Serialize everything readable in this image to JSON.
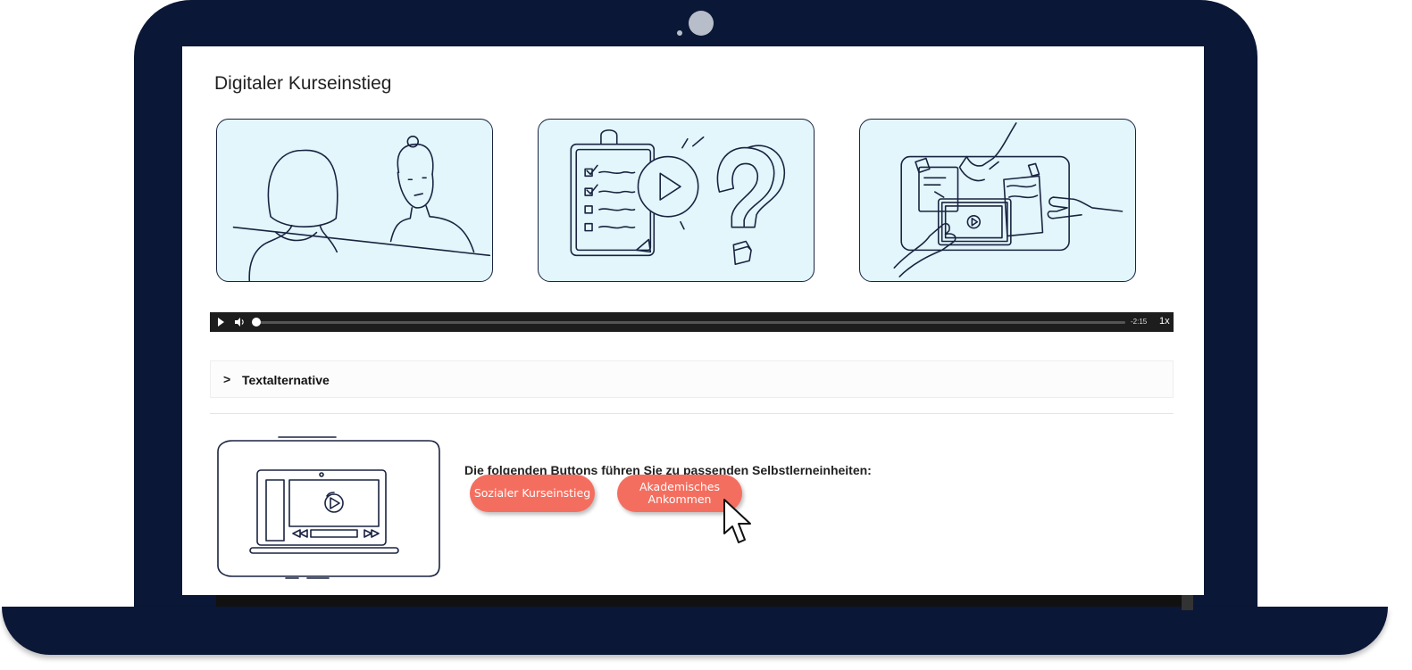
{
  "page": {
    "title": "Digitaler Kurseinstieg"
  },
  "player": {
    "time_remaining": "-2:15",
    "speed": "1x",
    "progress": 0.0
  },
  "accordion": {
    "label": "Textalternative",
    "chevron": ">"
  },
  "selection": {
    "prompt": "Die folgenden Buttons führen Sie zu passenden Selbstlerneinheiten:",
    "buttons": [
      {
        "label": "Sozialer Kurseinstieg"
      },
      {
        "label_line1": "Akademisches",
        "label_line2": "Ankommen"
      }
    ]
  },
  "colors": {
    "laptop_frame": "#0b1736",
    "slide_bg": "#e2f6fb",
    "button_accent": "#f46e5f",
    "player_bar": "#1d1d1d"
  },
  "icons": {
    "play": "play-icon",
    "volume": "volume-icon",
    "chevron": "chevron-right-icon",
    "cursor": "mouse-pointer-icon"
  }
}
